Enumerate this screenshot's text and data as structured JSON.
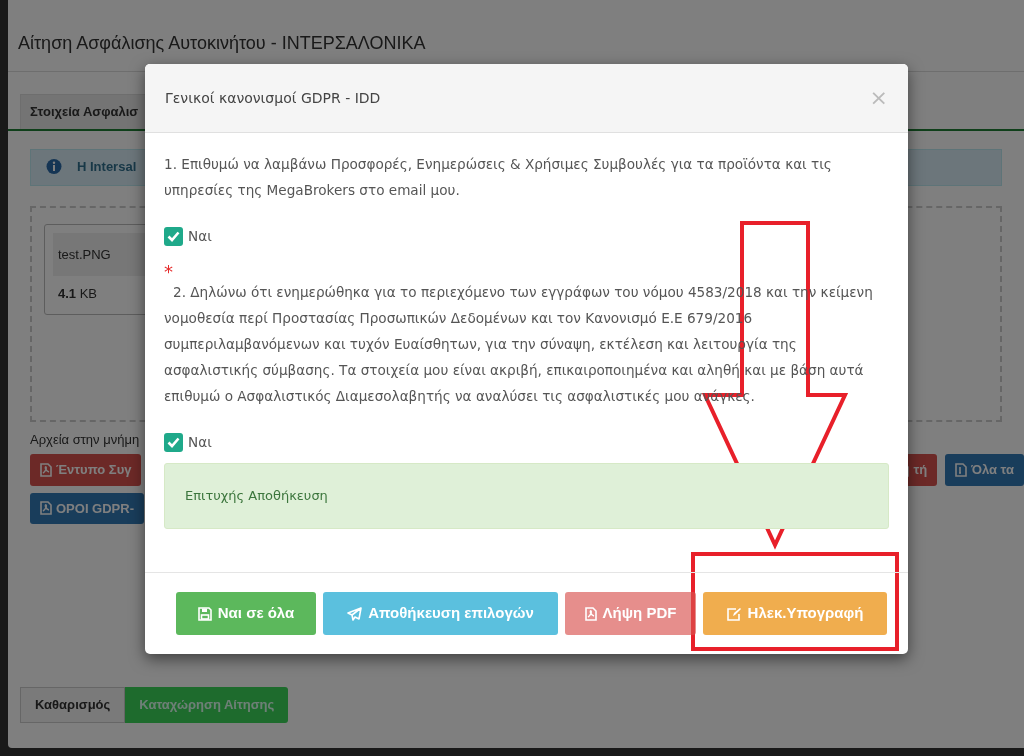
{
  "window": {
    "title": "Αίτηση Ασφάλισης Αυτοκινήτου - ΙΝΤΕΡΣΑΛΟΝΙΚΑ"
  },
  "background": {
    "tabs": [
      {
        "label": "Στοιχεία Ασφαλισ",
        "selected": true
      }
    ],
    "info_alert": "Η Intersal",
    "files": [
      {
        "name": "test.PNG",
        "size": "**4.1** KB"
      }
    ],
    "files_label": "Αρχεία στην μνήμη",
    "button_rows": [
      [
        {
          "label": "Έντυπο Συγ",
          "kind": "danger"
        },
        {
          "label": "τή",
          "kind": "danger"
        },
        {
          "label": "Όλα τα",
          "kind": "primary"
        }
      ],
      [
        {
          "label": "ΟΡΟΙ GDPR-",
          "kind": "primary"
        }
      ]
    ],
    "actions": [
      {
        "label": "Καθαρισμός",
        "kind": "default"
      },
      {
        "label": "Καταχώρηση Αίτησης",
        "kind": "success"
      }
    ]
  },
  "modal": {
    "title": "Γενικοί κανονισμοί GDPR - IDD",
    "close": "×",
    "consents": [
      {
        "text": "1. Επιθυμώ να λαμβάνω Προσφορές, Ενημερώσεις & Χρήσιμες Συμβουλές για τα προϊόντα και τις υπηρεσίες της MegaBrokers στο email μου.",
        "checkbox": {
          "label": "Ναι",
          "checked": true
        }
      },
      {
        "required_mark": "*",
        "text": "2. Δηλώνω ότι ενημερώθηκα για το περιεχόμενο των εγγράφων του νόμου 4583/2018 και την κείμενη νομοθεσία περί Προστασίας Προσωπικών Δεδομένων και τον Κανονισμό Ε.Ε 679/2016 συμπεριλαμβανόμενων και τυχόν Ευαίσθητων, για την σύναψη, εκτέλεση και λειτουργία της ασφαλιστικής σύμβασης. Τα στοιχεία μου είναι ακριβή, επικαιροποιημένα και αληθή και με βάση αυτά επιθυμώ ο Ασφαλιστικός Διαμεσολαβητής να αναλύσει τις ασφαλιστικές μου ανάγκες.",
        "checkbox": {
          "label": "Ναι",
          "checked": true
        }
      }
    ],
    "success_message": "Επιτυχής Αποθήκευση",
    "buttons": [
      {
        "label": "Ναι σε όλα",
        "kind": "success",
        "disabled": false
      },
      {
        "label": "Αποθήκευση επιλογών",
        "kind": "info",
        "disabled": false
      },
      {
        "label": "Λήψη PDF",
        "kind": "danger",
        "disabled": true
      },
      {
        "label": "Ηλεκ.Υπογραφή",
        "kind": "warning",
        "disabled": false
      }
    ]
  }
}
